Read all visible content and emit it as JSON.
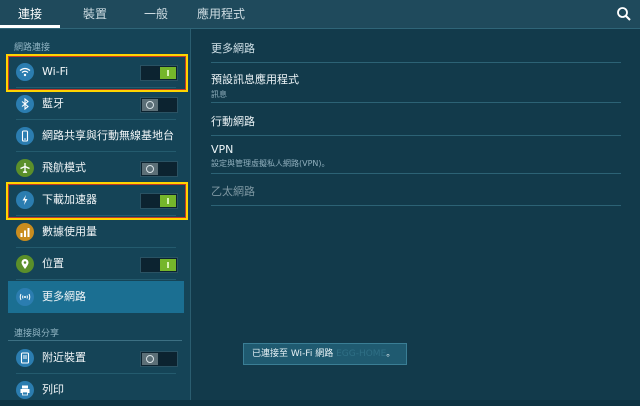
{
  "tabs": [
    "連接",
    "裝置",
    "一般",
    "應用程式"
  ],
  "sidebar": {
    "section_network": "網路連接",
    "section_share": "連接與分享",
    "items": [
      {
        "label": "Wi-Fi",
        "icon": "wifi-icon",
        "toggle": "on"
      },
      {
        "label": "藍牙",
        "icon": "bluetooth-icon",
        "toggle": "off"
      },
      {
        "label": "網路共享與行動無線基地台",
        "icon": "tethering-icon"
      },
      {
        "label": "飛航模式",
        "icon": "airplane-icon",
        "toggle": "off"
      },
      {
        "label": "下載加速器",
        "icon": "download-booster-icon",
        "toggle": "on"
      },
      {
        "label": "數據使用量",
        "icon": "data-usage-icon"
      },
      {
        "label": "位置",
        "icon": "location-icon",
        "toggle": "on"
      },
      {
        "label": "更多網路",
        "icon": "more-networks-icon",
        "selected": true
      },
      {
        "label": "附近裝置",
        "icon": "nearby-devices-icon",
        "toggle": "off"
      },
      {
        "label": "列印",
        "icon": "print-icon"
      }
    ]
  },
  "main": {
    "header": "更多網路",
    "rows": [
      {
        "title": "預設訊息應用程式",
        "subtitle": "訊息"
      },
      {
        "title": "行動網路",
        "subtitle": ""
      },
      {
        "title": "VPN",
        "subtitle": "設定與管理虛擬私人網路(VPN)。"
      },
      {
        "title": "乙太網路",
        "subtitle": "",
        "disabled": true
      }
    ],
    "toast_prefix": "已連接至 Wi-Fi 網路",
    "toast_ssid": "EGG-HOME",
    "toast_suffix": "。"
  },
  "colors": {
    "accent": "#1b6f92",
    "toggle_on": "#75b62b",
    "highlight": "#ffd400"
  }
}
